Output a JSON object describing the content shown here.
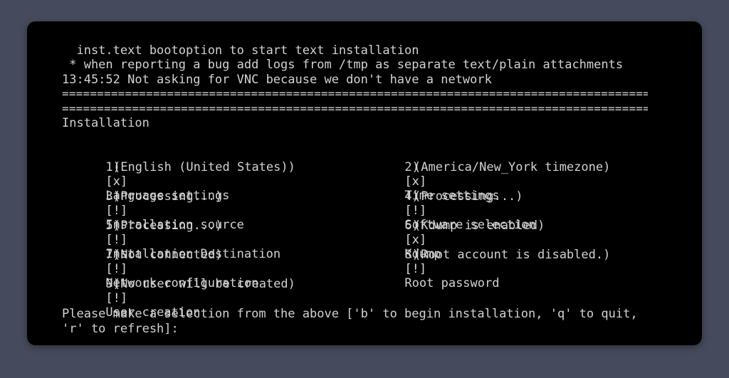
{
  "terminal": {
    "top_lines": [
      "  inst.text bootoption to start text installation",
      " * when reporting a bug add logs from /tmp as separate text/plain attachments",
      "13:45:52 Not asking for VNC because we don't have a network"
    ],
    "heading": "Installation",
    "left_items": [
      {
        "number": "1)",
        "status": "[x]",
        "label": "Language settings",
        "detail": "(English (United States))"
      },
      {
        "number": "3)",
        "status": "[!]",
        "label": "Installation source",
        "detail": "(Processing...)"
      },
      {
        "number": "5)",
        "status": "[!]",
        "label": "Installation Destination",
        "detail": "(Processing...)"
      },
      {
        "number": "7)",
        "status": "[!]",
        "label": "Network configuration",
        "detail": "(Not connected)"
      },
      {
        "number": "9)",
        "status": "[!]",
        "label": "User creation",
        "detail": "(No user will be created)"
      }
    ],
    "right_items": [
      {
        "number": "2)",
        "status": "[x]",
        "label": "Time settings",
        "detail": "(America/New_York timezone)"
      },
      {
        "number": "4)",
        "status": "[!]",
        "label": "Software selection",
        "detail": "(Processing...)"
      },
      {
        "number": "6)",
        "status": "[x]",
        "label": "Kdump",
        "detail": "(Kdump is enabled)"
      },
      {
        "number": "8)",
        "status": "[!]",
        "label": "Root password",
        "detail": "(Root account is disabled.)"
      }
    ],
    "prompt_lines": [
      "Please make a selection from the above ['b' to begin installation, 'q' to quit,",
      "'r' to refresh]:"
    ]
  }
}
